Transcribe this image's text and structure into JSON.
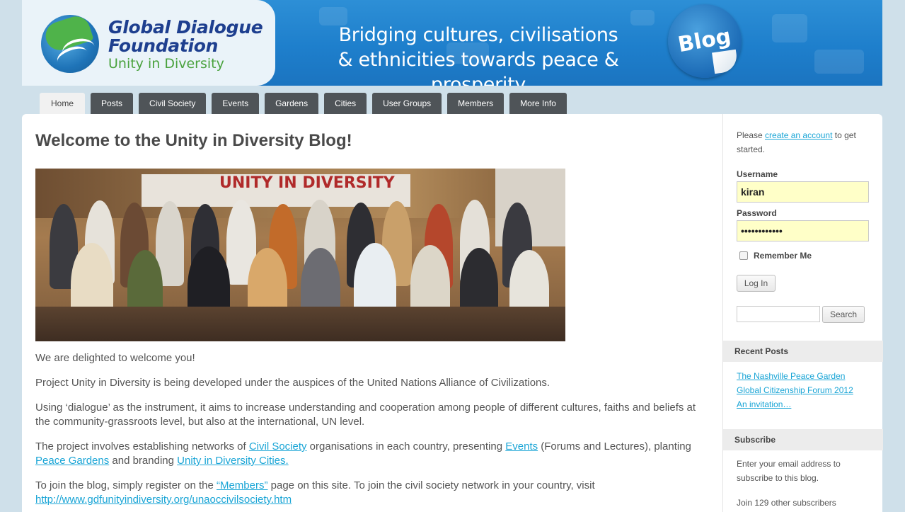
{
  "header": {
    "logo_line1": "Global Dialogue",
    "logo_line2": "Foundation",
    "logo_tagline": "Unity in Diversity",
    "tagline_line1": "Bridging cultures, civilisations",
    "tagline_line2": "& ethnicities towards peace & prosperity",
    "badge": "Blog"
  },
  "nav": {
    "tabs": [
      {
        "label": "Home",
        "active": true
      },
      {
        "label": "Posts"
      },
      {
        "label": "Civil Society"
      },
      {
        "label": "Events"
      },
      {
        "label": "Gardens"
      },
      {
        "label": "Cities"
      },
      {
        "label": "User Groups"
      },
      {
        "label": "Members"
      },
      {
        "label": "More Info"
      }
    ]
  },
  "main": {
    "title": "Welcome to the Unity in Diversity Blog!",
    "photo_banner_text": "UNITY IN DIVERSITY",
    "p1": "We are delighted to welcome you!",
    "p2": "Project Unity in Diversity is being developed under the auspices of the United Nations Alliance of Civilizations.",
    "p3": "Using ‘dialogue’ as the instrument, it aims to increase understanding and cooperation among people of different cultures, faiths and beliefs at the community-grassroots level, but also at the international, UN level.",
    "p4_a": "The project involves establishing networks of ",
    "p4_link1": "Civil Society",
    "p4_b": " organisations in each country, presenting  ",
    "p4_link2": "Events",
    "p4_c": " (Forums and Lectures), planting ",
    "p4_link3": "Peace Gardens",
    "p4_d": " and branding ",
    "p4_link4": "Unity in Diversity Cities.",
    "p5_a": "To join the blog, simply register on the ",
    "p5_link1": "“Members”",
    "p5_b": " page on this site.  To join the civil society network in your country, visit",
    "p5_link2": "http://www.gdfunityindiversity.org/unaoccivilsociety.htm"
  },
  "sidebar": {
    "note_a": "Please ",
    "note_link": "create an account",
    "note_b": " to get started.",
    "username_label": "Username",
    "username_value": "kiran",
    "password_label": "Password",
    "password_value": "••••••••••••",
    "remember_label": "Remember Me",
    "login_button": "Log In",
    "search_button": "Search",
    "recent_title": "Recent Posts",
    "recent_posts": [
      "The Nashville Peace Garden",
      "Global Citizenship Forum 2012",
      "An invitation…"
    ],
    "subscribe_title": "Subscribe",
    "subscribe_text": "Enter your email address to subscribe to this blog.",
    "subscribers_text": "Join 129 other subscribers"
  }
}
